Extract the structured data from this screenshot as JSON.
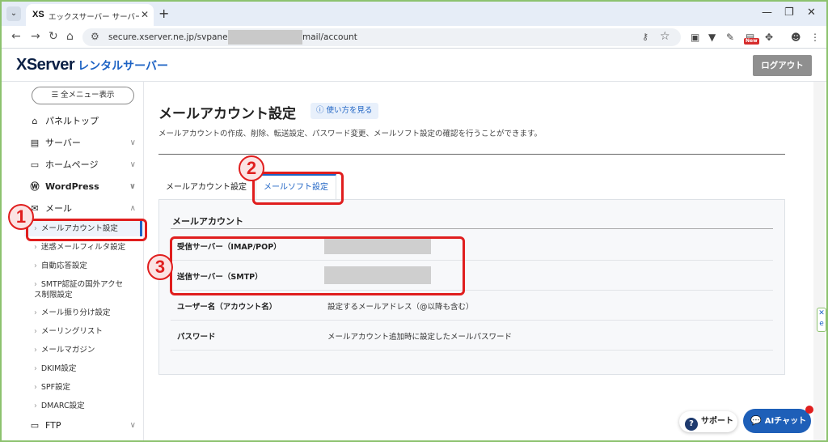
{
  "browser": {
    "tab_title": "エックスサーバー サーバーパネル - メール",
    "tab_favicon": "XS",
    "url_prefix": "secure.xserver.ne.jp/svpanel/xserver",
    "url_suffix": "mail/account"
  },
  "header": {
    "logo_main": "XServer",
    "logo_sub": "レンタルサーバー",
    "logout_label": "ログアウト"
  },
  "sidebar": {
    "menu_button": "全メニュー表示",
    "items": [
      {
        "label": "パネルトップ",
        "icon": "home-icon"
      },
      {
        "label": "サーバー",
        "icon": "server-icon"
      },
      {
        "label": "ホームページ",
        "icon": "window-icon"
      },
      {
        "label": "WordPress",
        "icon": "wordpress-icon"
      },
      {
        "label": "メール",
        "icon": "mail-icon"
      }
    ],
    "mail_subitems": [
      "メールアカウント設定",
      "迷惑メールフィルタ設定",
      "自動応答設定",
      "SMTP認証の国外アクセス制限設定",
      "メール振り分け設定",
      "メーリングリスト",
      "メールマガジン",
      "DKIM設定",
      "SPF設定",
      "DMARC設定"
    ],
    "ftp_label": "FTP"
  },
  "main": {
    "title": "メールアカウント設定",
    "help_link": "使い方を見る",
    "description": "メールアカウントの作成、削除、転送設定、パスワード変更、メールソフト設定の確認を行うことができます。",
    "tabs": [
      {
        "label": "メールアカウント設定",
        "active": false
      },
      {
        "label": "メールソフト設定",
        "active": true
      }
    ],
    "section_title": "メールアカウント",
    "rows": [
      {
        "label": "受信サーバー（IMAP/POP）",
        "value": ""
      },
      {
        "label": "送信サーバー（SMTP）",
        "value": ""
      },
      {
        "label": "ユーザー名（アカウント名）",
        "value": "設定するメールアドレス（@以降も含む）"
      },
      {
        "label": "パスワード",
        "value": "メールアカウント追加時に設定したメールパスワード"
      }
    ]
  },
  "annotations": [
    "1",
    "2",
    "3"
  ],
  "floating": {
    "support_label": "サポート",
    "ai_chat_label": "AIチャット"
  },
  "colors": {
    "accent": "#1e63c4",
    "annotation": "#e01e1e",
    "logout_bg": "#8f8f8f"
  }
}
